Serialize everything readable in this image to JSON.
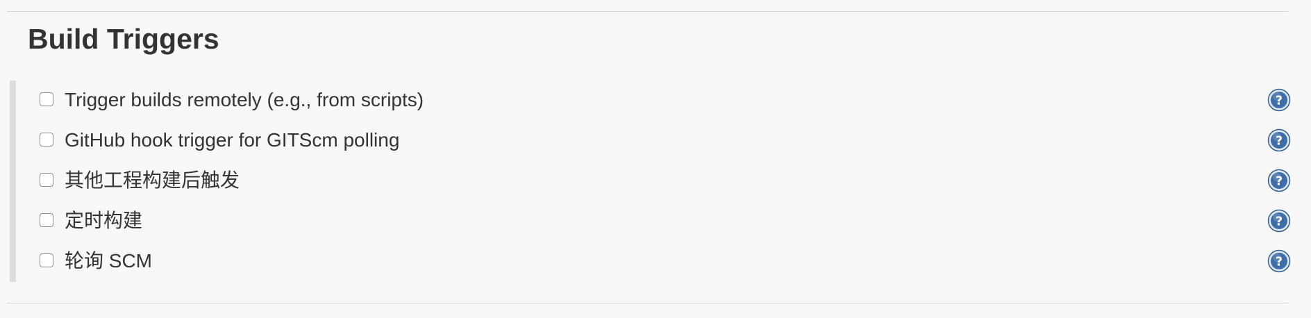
{
  "section": {
    "title": "Build Triggers"
  },
  "triggers": [
    {
      "label": "Trigger builds remotely (e.g., from scripts)",
      "checked": false,
      "help_icon": "help-icon"
    },
    {
      "label": "GitHub hook trigger for GITScm polling",
      "checked": false,
      "help_icon": "help-icon"
    },
    {
      "label": "其他工程构建后触发",
      "checked": false,
      "help_icon": "help-icon"
    },
    {
      "label": "定时构建",
      "checked": false,
      "help_icon": "help-icon"
    },
    {
      "label": "轮询 SCM",
      "checked": false,
      "help_icon": "help-icon"
    }
  ],
  "colors": {
    "background": "#f8f8f8",
    "text": "#333333",
    "help_icon_fill": "#3d6ea8",
    "group_bar": "#dddddd"
  }
}
